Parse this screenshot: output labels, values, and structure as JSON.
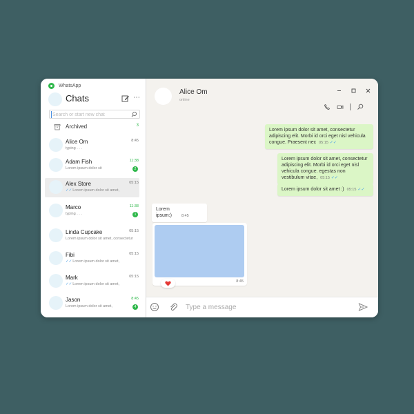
{
  "app": {
    "name": "WhatsApp"
  },
  "sidebar": {
    "title": "Chats",
    "search_placeholder": "Search or start new chat",
    "archived": {
      "label": "Archived",
      "count": "3"
    },
    "chats": [
      {
        "name": "Alice Om",
        "preview": "typing . . .",
        "time": "8:45",
        "unread": false,
        "badge": "",
        "ticks": false
      },
      {
        "name": "Adam Fish",
        "preview": "Lorem ipsum dolor sit",
        "time": "11:38",
        "unread": true,
        "badge": "2",
        "ticks": false
      },
      {
        "name": "Alex Store",
        "preview": "Lorem ipsum dolor sit amet,",
        "time": "05:15",
        "unread": false,
        "badge": "",
        "ticks": true,
        "selected": true
      },
      {
        "name": "Marco",
        "preview": "typing . . .",
        "time": "11:38",
        "unread": true,
        "badge": "1",
        "ticks": false
      },
      {
        "name": "Linda Cupcake",
        "preview": "Lorem ipsum dolor sit amet, consectetur",
        "time": "05:15",
        "unread": false,
        "badge": "",
        "ticks": false
      },
      {
        "name": "Fibi",
        "preview": "Lorem ipsum dolor sit amet,",
        "time": "05:15",
        "unread": false,
        "badge": "",
        "ticks": true
      },
      {
        "name": "Mark",
        "preview": "Lorem ipsum dolor sit amet,",
        "time": "05:15",
        "unread": false,
        "badge": "",
        "ticks": true
      },
      {
        "name": "Jason",
        "preview": "Lorem ipsum dolor sit amet,",
        "time": "8:45",
        "unread": true,
        "badge": "4",
        "ticks": false
      }
    ]
  },
  "conversation": {
    "contact_name": "Alice Om",
    "contact_status": "online",
    "messages": [
      {
        "text": "Lorem ipsum dolor sit amet, consectetur adipiscing elit. Morbi id orci eget nisl vehicula congue. Praesent nec",
        "time": "05:15"
      },
      {
        "text": "Lorem ipsum dolor sit amet, consectetur adipiscing elit. Morbi id orci eget nisl vehicula congue. egestas non vestibulum vitae,",
        "time": "05:15"
      },
      {
        "text": "Lorem ipsum dolor sit amet :)",
        "time": "05:15"
      },
      {
        "text": "Lorem ipsum:)",
        "time": "8:45"
      }
    ],
    "media_time": "8:45",
    "composer_placeholder": "Type a message"
  },
  "colors": {
    "background": "#3e5f63",
    "accent_green": "#2fb84b",
    "outgoing_bubble": "#dbf6c6",
    "chat_bg": "#f4f2ee",
    "media_placeholder": "#aeccf1",
    "tick_blue": "#4aa0e6",
    "heart_red": "#e53935"
  }
}
